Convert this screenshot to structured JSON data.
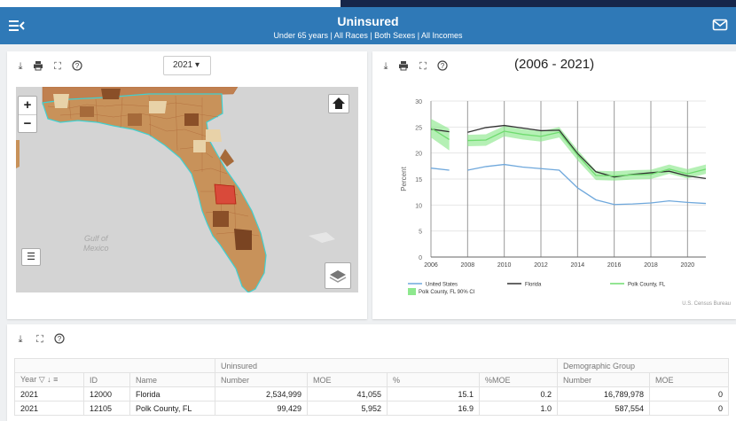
{
  "header": {
    "title": "Uninsured",
    "subtitle": "Under 65 years | All Races | Both Sexes | All Incomes"
  },
  "map_panel": {
    "year_select": "2021",
    "gulf_label_line1": "Gulf of",
    "gulf_label_line2": "Mexico"
  },
  "chart_panel": {
    "title": "(2006 - 2021)"
  },
  "chart_data": {
    "type": "line",
    "title": "(2006 - 2021)",
    "ylabel": "Percent",
    "xlim": [
      2006,
      2021
    ],
    "ylim": [
      0,
      30
    ],
    "xticks": [
      "2006",
      "2008",
      "2010",
      "2012",
      "2014",
      "2016",
      "2018",
      "2020"
    ],
    "yticks": [
      "0",
      "5",
      "10",
      "15",
      "20",
      "25",
      "30"
    ],
    "series": [
      {
        "name": "United States",
        "color": "#6fa8dc",
        "segments": [
          {
            "x": [
              2006,
              2007
            ],
            "y": [
              17.1,
              16.7
            ]
          },
          {
            "x": [
              2008,
              2009,
              2010,
              2011,
              2012,
              2013,
              2014,
              2015,
              2016,
              2017,
              2018,
              2019,
              2020,
              2021
            ],
            "y": [
              16.7,
              17.4,
              17.8,
              17.3,
              17.0,
              16.7,
              13.3,
              11.0,
              10.1,
              10.2,
              10.4,
              10.8,
              10.5,
              10.3
            ]
          }
        ]
      },
      {
        "name": "Florida",
        "color": "#333333",
        "segments": [
          {
            "x": [
              2006,
              2007
            ],
            "y": [
              24.6,
              24.1
            ]
          },
          {
            "x": [
              2008,
              2009,
              2010,
              2011,
              2012,
              2013,
              2014,
              2015,
              2016,
              2017,
              2018,
              2019,
              2020,
              2021
            ],
            "y": [
              24.0,
              24.9,
              25.3,
              24.8,
              24.3,
              24.4,
              19.9,
              16.4,
              15.4,
              15.9,
              16.2,
              16.5,
              15.6,
              15.1
            ]
          }
        ]
      },
      {
        "name": "Polk County, FL",
        "color": "#6fdc6f",
        "segments": [
          {
            "x": [
              2006,
              2007
            ],
            "y": [
              24.8,
              22.6
            ]
          },
          {
            "x": [
              2008,
              2009,
              2010,
              2011,
              2012,
              2013,
              2014,
              2015,
              2016,
              2017,
              2018,
              2019,
              2020,
              2021
            ],
            "y": [
              22.4,
              22.5,
              24.2,
              23.6,
              23.2,
              24.0,
              19.6,
              15.7,
              15.6,
              15.8,
              15.9,
              16.9,
              16.0,
              16.9
            ]
          }
        ]
      }
    ],
    "ci_band": {
      "name": "Polk County, FL 90% CI",
      "color": "#8ee88e",
      "segments": [
        {
          "x": [
            2006,
            2007
          ],
          "low": [
            23.0,
            20.5
          ],
          "high": [
            26.6,
            24.7
          ]
        },
        {
          "x": [
            2008,
            2009,
            2010,
            2011,
            2012,
            2013,
            2014,
            2015,
            2016,
            2017,
            2018,
            2019,
            2020,
            2021
          ],
          "low": [
            21.3,
            21.4,
            23.2,
            22.6,
            22.2,
            23.0,
            18.6,
            14.8,
            14.7,
            14.9,
            15.0,
            16.0,
            15.1,
            16.0
          ],
          "high": [
            23.5,
            23.6,
            25.2,
            24.6,
            24.2,
            25.0,
            20.6,
            16.6,
            16.5,
            16.7,
            16.8,
            17.8,
            16.9,
            17.8
          ]
        }
      ]
    },
    "credit": "U.S. Census Bureau"
  },
  "table": {
    "group_headers": [
      "",
      "Uninsured",
      "Demographic Group"
    ],
    "columns": [
      "Year",
      "ID",
      "Name",
      "Number",
      "MOE",
      "%",
      "%MOE",
      "Number",
      "MOE"
    ],
    "rows": [
      [
        "2021",
        "12000",
        "Florida",
        "2,534,999",
        "41,055",
        "15.1",
        "0.2",
        "16,789,978",
        "0"
      ],
      [
        "2021",
        "12105",
        "Polk County, FL",
        "99,429",
        "5,952",
        "16.9",
        "1.0",
        "587,554",
        "0"
      ]
    ]
  },
  "icons": [
    "menu-icon",
    "mail-icon",
    "download-icon",
    "print-icon",
    "fullscreen-icon",
    "help-icon",
    "home-icon",
    "legend-list-icon",
    "layers-icon",
    "filter-icon",
    "sort-icon",
    "column-menu-icon"
  ],
  "colors": {
    "header": "#2f79b7",
    "selected_county": "#d94a3a",
    "polk": "#6fdc6f",
    "us": "#6fa8dc",
    "florida": "#333333"
  }
}
